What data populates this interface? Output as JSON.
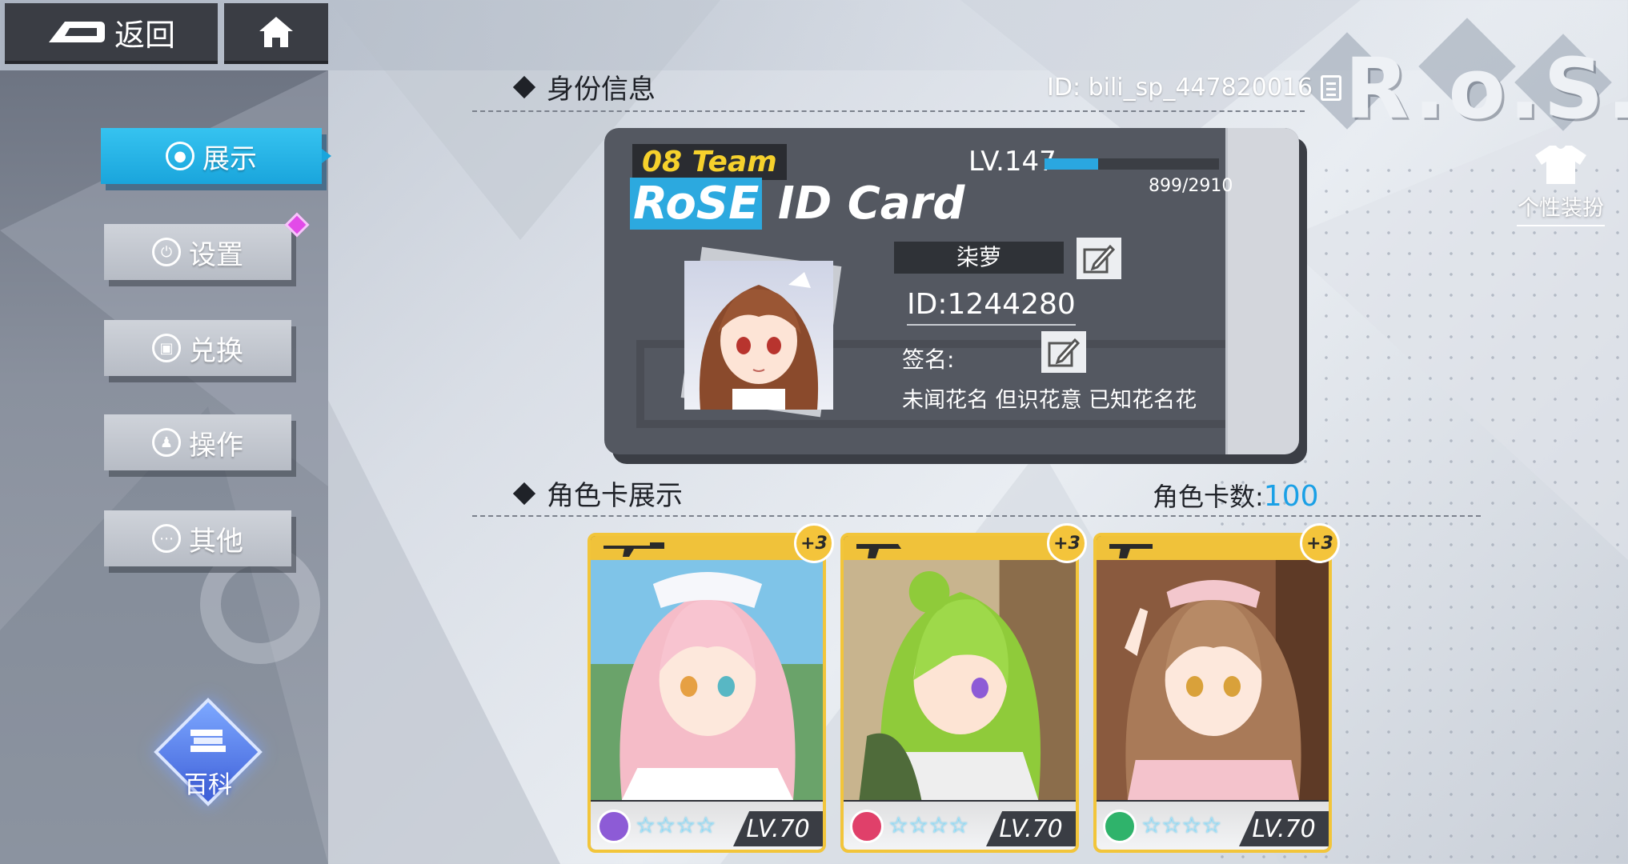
{
  "nav": {
    "back_label": "返回",
    "home_icon": "home-icon"
  },
  "sidebar": {
    "items": [
      {
        "label": "展示",
        "icon": "user-circle-icon",
        "active": true
      },
      {
        "label": "设置",
        "icon": "power-icon",
        "active": false
      },
      {
        "label": "兑换",
        "icon": "bag-icon",
        "active": false
      },
      {
        "label": "操作",
        "icon": "person-icon",
        "active": false
      },
      {
        "label": "其他",
        "icon": "more-icon",
        "active": false
      }
    ],
    "wiki_label": "百科"
  },
  "header": {
    "logo_text": "R.o.S.E",
    "outfit_label": "个性装扮"
  },
  "identity": {
    "section_title": "身份信息",
    "account_id": "ID: bili_sp_447820016",
    "card": {
      "team_tag": "08 Team",
      "title_prefix": "RoSE",
      "title_suffix": " ID Card",
      "level": "LV.147",
      "xp_text": "899/2910",
      "xp_fraction": 0.309,
      "nickname": "柒萝",
      "player_id": "ID:1244280",
      "signature_label": "签名:",
      "signature_text": "未闻花名 但识花意 已知花名花"
    }
  },
  "characters": {
    "section_title": "角色卡展示",
    "count_label": "角色卡数:",
    "count_value": "100",
    "cards": [
      {
        "plus": "+3",
        "level": "LV.70",
        "stars": "☆☆☆☆",
        "element_color": "#8d5bd6"
      },
      {
        "plus": "+3",
        "level": "LV.70",
        "stars": "☆☆☆☆",
        "element_color": "#e0406a"
      },
      {
        "plus": "+3",
        "level": "LV.70",
        "stars": "☆☆☆☆",
        "element_color": "#2fb36b"
      }
    ]
  },
  "colors": {
    "accent": "#1aa5dc",
    "card_gold": "#f2c53a"
  }
}
